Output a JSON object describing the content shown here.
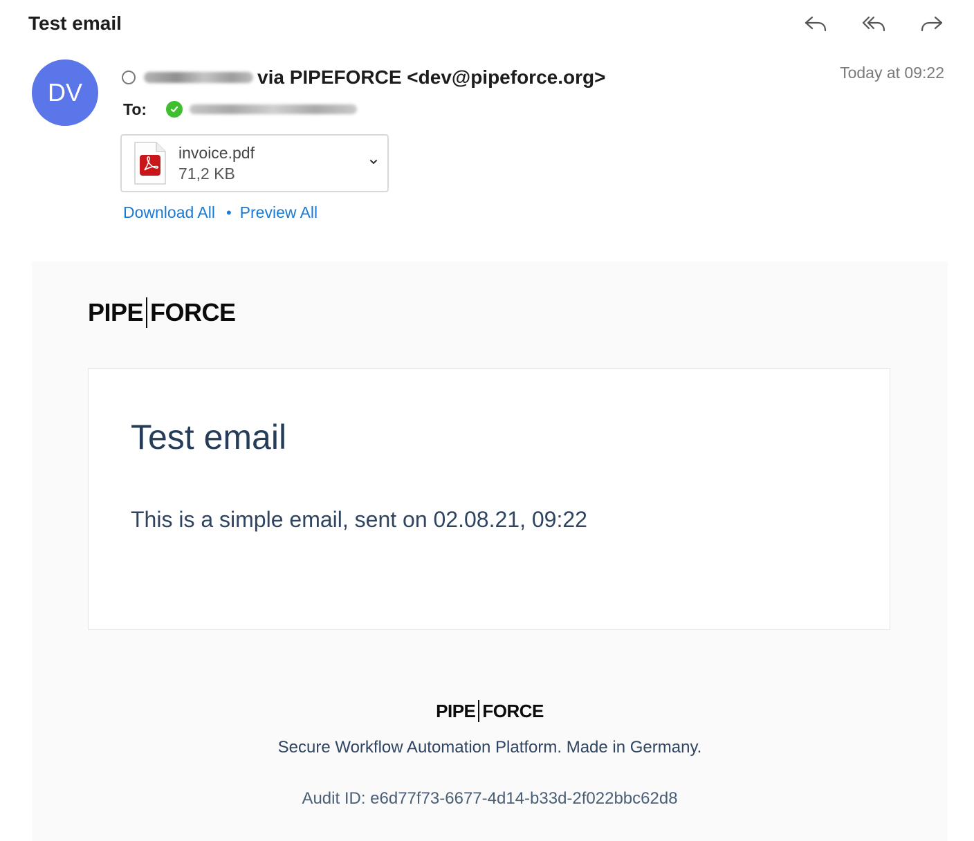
{
  "header": {
    "subject": "Test email"
  },
  "toolbar": {
    "reply_icon": "reply-icon",
    "reply_all_icon": "reply-all-icon",
    "forward_icon": "forward-icon"
  },
  "sender": {
    "avatar_initials": "DV",
    "avatar_color": "#5a76e8",
    "from_text": "via PIPEFORCE <dev@pipeforce.org>",
    "date": "Today at 09:22"
  },
  "recipients": {
    "to_label": "To:"
  },
  "attachment": {
    "name": "invoice.pdf",
    "size": "71,2 KB",
    "icon": "pdf-file-icon"
  },
  "attachment_actions": {
    "download_all": "Download All",
    "separator": "•",
    "preview_all": "Preview All",
    "link_color": "#1a7ad4"
  },
  "body": {
    "logo_left": "PIPE",
    "logo_right": "FORCE",
    "title": "Test email",
    "text": "This is a simple email, sent on 02.08.21, 09:22",
    "tagline": "Secure Workflow Automation Platform. Made in Germany.",
    "audit": "Audit ID: e6d77f73-6677-4d14-b33d-2f022bbc62d8"
  }
}
